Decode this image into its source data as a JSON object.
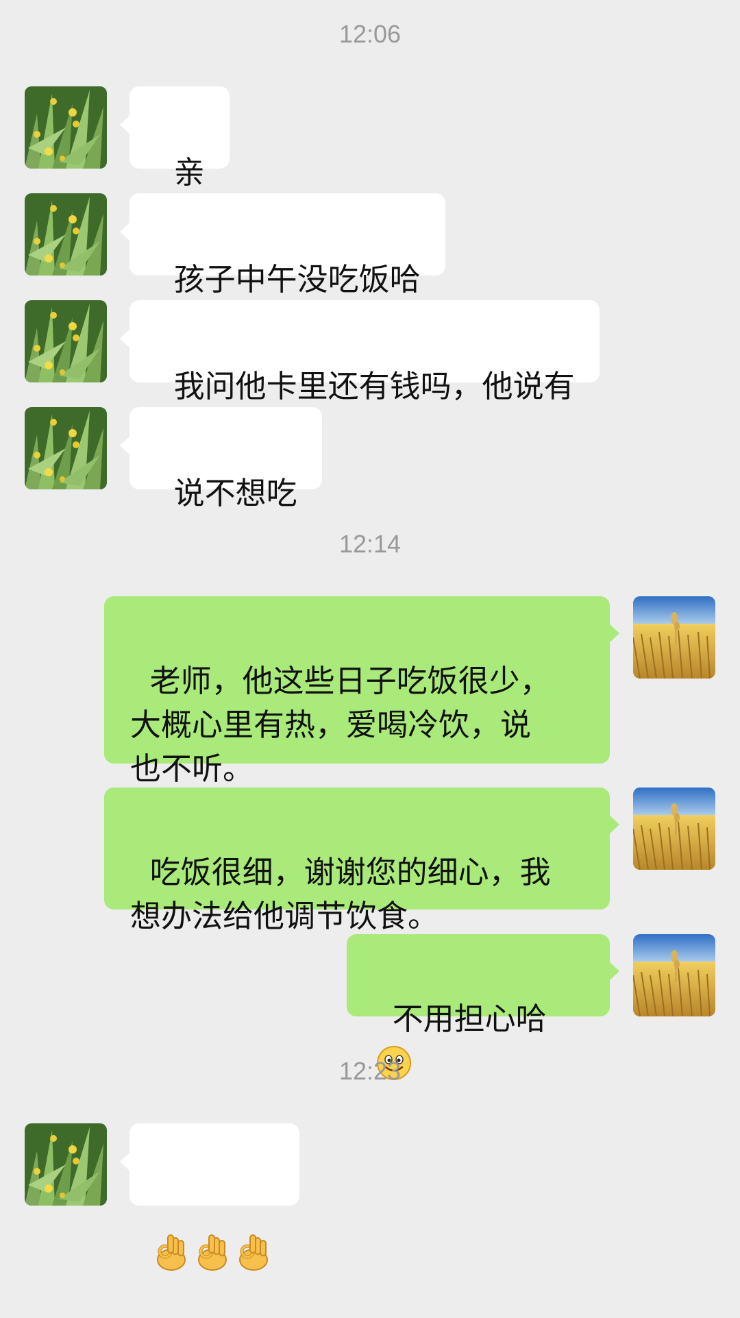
{
  "chat": {
    "timestamps": [
      "12:06",
      "12:14",
      "12:23"
    ],
    "messages_in": [
      {
        "text": "亲"
      },
      {
        "text": "孩子中午没吃饭哈"
      },
      {
        "text": "我问他卡里还有钱吗，他说有"
      },
      {
        "text": "说不想吃"
      }
    ],
    "messages_out": [
      {
        "text": "老师，他这些日子吃饭很少，\n大概心里有热，爱喝冷饮，说\n也不听。"
      },
      {
        "text": "吃饭很细，谢谢您的细心，我\n想办法给他调节饮食。"
      },
      {
        "text": "不用担心哈",
        "emoji": "smiley-face-icon"
      }
    ],
    "last_in": {
      "emoji": "ok-hand-icon",
      "count": 3
    },
    "colors": {
      "background": "#ededed",
      "bubble_in": "#ffffff",
      "bubble_out": "#a9ea7a",
      "timestamp": "#999999"
    }
  }
}
